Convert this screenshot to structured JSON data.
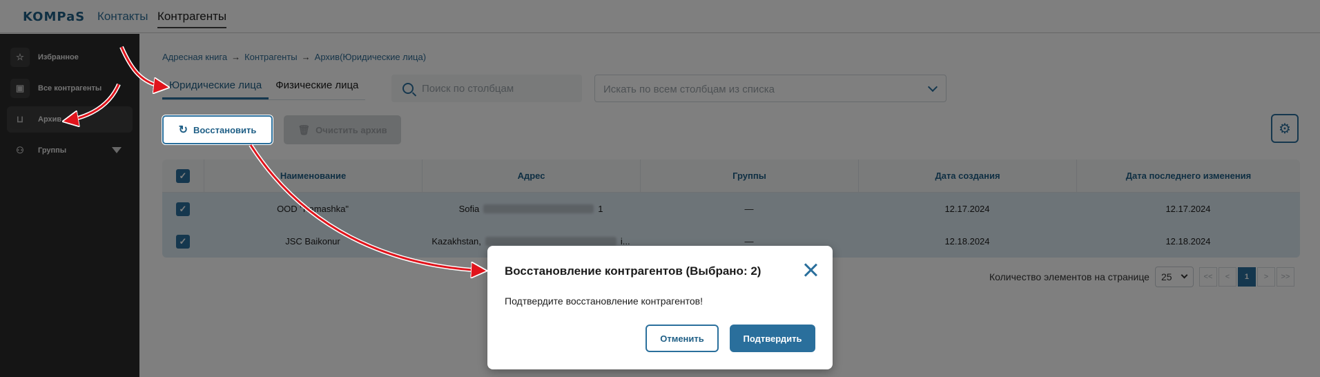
{
  "header": {
    "logo": "KOMPaS",
    "nav": [
      "Контакты",
      "Контрагенты"
    ]
  },
  "sidebar": {
    "items": [
      {
        "label": "Избранное",
        "icon": "star-icon"
      },
      {
        "label": "Все контрагенты",
        "icon": "contact-card-icon"
      },
      {
        "label": "Архив",
        "icon": "archive-icon"
      },
      {
        "label": "Группы",
        "icon": "groups-icon"
      }
    ]
  },
  "breadcrumb": [
    "Адресная книга",
    "Контрагенты",
    "Архив(Юридические лица)"
  ],
  "tabs": [
    "Юридические лица",
    "Физические лица"
  ],
  "search": {
    "columns_placeholder": "Поиск по столбцам",
    "all_placeholder": "Искать по всем столбцам из списка"
  },
  "toolbar": {
    "restore_label": "Восстановить",
    "clear_label": "Очистить архив"
  },
  "table": {
    "headers": [
      "Наименование",
      "Адрес",
      "Группы",
      "Дата создания",
      "Дата последнего изменения"
    ],
    "rows": [
      {
        "name": "OOD \"Pamashka\"",
        "addr_start": "Sofia",
        "addr_end": "1",
        "groups": "—",
        "created": "12.17.2024",
        "modified": "12.17.2024"
      },
      {
        "name": "JSC Baikonur",
        "addr_start": "Kazakhstan,",
        "addr_end": "i...",
        "groups": "—",
        "created": "12.18.2024",
        "modified": "12.18.2024"
      }
    ]
  },
  "pagination": {
    "label": "Количество элементов на странице",
    "per_page": "25",
    "first": "<<",
    "prev": "<",
    "current": "1",
    "next": ">",
    "last": ">>"
  },
  "modal": {
    "title": "Восстановление контрагентов (Выбрано: 2)",
    "body": "Подтвердите восстановление контрагентов!",
    "cancel": "Отменить",
    "confirm": "Подтвердить"
  },
  "colors": {
    "accent": "#2a6f9c",
    "sidebar_bg": "#2b2b2b",
    "annotation_arrow": "#e0141c"
  }
}
